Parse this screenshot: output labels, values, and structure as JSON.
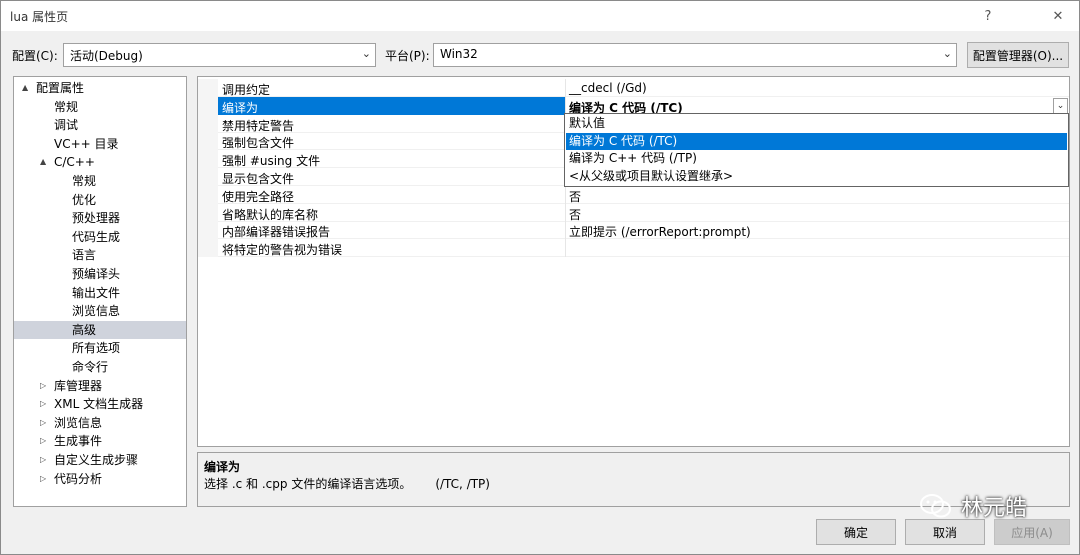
{
  "window": {
    "title": "lua 属性页",
    "help_glyph": "?",
    "close_glyph": "✕"
  },
  "toolbar": {
    "config_label": "配置(C):",
    "config_value": "活动(Debug)",
    "platform_label": "平台(P):",
    "platform_value": "Win32",
    "config_manager": "配置管理器(O)..."
  },
  "tree": [
    {
      "label": "配置属性",
      "level": 0,
      "expander": "▲"
    },
    {
      "label": "常规",
      "level": 1,
      "expander": ""
    },
    {
      "label": "调试",
      "level": 1,
      "expander": ""
    },
    {
      "label": "VC++ 目录",
      "level": 1,
      "expander": ""
    },
    {
      "label": "C/C++",
      "level": 1,
      "expander": "▲"
    },
    {
      "label": "常规",
      "level": 2,
      "expander": ""
    },
    {
      "label": "优化",
      "level": 2,
      "expander": ""
    },
    {
      "label": "预处理器",
      "level": 2,
      "expander": ""
    },
    {
      "label": "代码生成",
      "level": 2,
      "expander": ""
    },
    {
      "label": "语言",
      "level": 2,
      "expander": ""
    },
    {
      "label": "预编译头",
      "level": 2,
      "expander": ""
    },
    {
      "label": "输出文件",
      "level": 2,
      "expander": ""
    },
    {
      "label": "浏览信息",
      "level": 2,
      "expander": ""
    },
    {
      "label": "高级",
      "level": 2,
      "expander": "",
      "selected": true
    },
    {
      "label": "所有选项",
      "level": 2,
      "expander": ""
    },
    {
      "label": "命令行",
      "level": 2,
      "expander": ""
    },
    {
      "label": "库管理器",
      "level": 1,
      "expander": "▷"
    },
    {
      "label": "XML 文档生成器",
      "level": 1,
      "expander": "▷"
    },
    {
      "label": "浏览信息",
      "level": 1,
      "expander": "▷"
    },
    {
      "label": "生成事件",
      "level": 1,
      "expander": "▷"
    },
    {
      "label": "自定义生成步骤",
      "level": 1,
      "expander": "▷"
    },
    {
      "label": "代码分析",
      "level": 1,
      "expander": "▷"
    }
  ],
  "properties": [
    {
      "name": "调用约定",
      "value": "__cdecl (/Gd)"
    },
    {
      "name": "编译为",
      "value": "编译为 C 代码 (/TC)",
      "selected": true
    },
    {
      "name": "禁用特定警告",
      "value": ""
    },
    {
      "name": "强制包含文件",
      "value": ""
    },
    {
      "name": "强制 #using 文件",
      "value": ""
    },
    {
      "name": "显示包含文件",
      "value": ""
    },
    {
      "name": "使用完全路径",
      "value": "否"
    },
    {
      "name": "省略默认的库名称",
      "value": "否"
    },
    {
      "name": "内部编译器错误报告",
      "value": "立即提示 (/errorReport:prompt)"
    },
    {
      "name": "将特定的警告视为错误",
      "value": ""
    }
  ],
  "dropdown": {
    "caret": "⌄",
    "options": [
      {
        "label": "默认值"
      },
      {
        "label": "编译为 C 代码 (/TC)",
        "highlighted": true
      },
      {
        "label": "编译为 C++ 代码 (/TP)"
      },
      {
        "label": "<从父级或项目默认设置继承>"
      }
    ]
  },
  "description": {
    "title": "编译为",
    "text": "选择 .c 和 .cpp 文件的编译语言选项。",
    "switches": "(/TC, /TP)"
  },
  "buttons": {
    "ok": "确定",
    "cancel": "取消",
    "apply": "应用(A)"
  },
  "watermark": {
    "text": "林元皓",
    "icon": "wechat-icon"
  }
}
